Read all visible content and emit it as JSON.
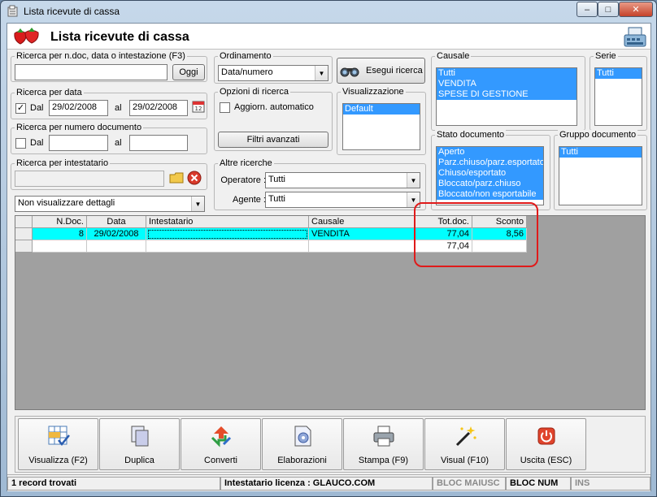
{
  "window": {
    "title": "Lista ricevute di cassa",
    "controls": {
      "minimize": "–",
      "maximize": "□",
      "close": "✕"
    }
  },
  "header": {
    "title": "Lista ricevute di cassa"
  },
  "search": {
    "ndoc": {
      "label": "Ricerca per n.doc, data o intestazione (F3)",
      "value": "",
      "today_button": "Oggi"
    },
    "by_date": {
      "label": "Ricerca per data",
      "checked": true,
      "from_label": "Dal",
      "from": "29/02/2008",
      "to_label": "al",
      "to": "29/02/2008"
    },
    "by_number": {
      "label": "Ricerca per numero documento",
      "checked": false,
      "from_label": "Dal",
      "from": "",
      "to_label": "al",
      "to": ""
    },
    "by_holder": {
      "label": "Ricerca per intestatario",
      "value": ""
    },
    "details_combo": {
      "value": "Non visualizzare dettagli"
    }
  },
  "ordering": {
    "label": "Ordinamento",
    "value": "Data/numero"
  },
  "execute_button": "Esegui ricerca",
  "options": {
    "label": "Opzioni di ricerca",
    "auto_update_label": "Aggiorn. automatico",
    "auto_update": false,
    "advanced_filters_button": "Filtri avanzati"
  },
  "view": {
    "label": "Visualizzazione",
    "items": [
      {
        "text": "Default",
        "selected": true
      }
    ]
  },
  "other": {
    "label": "Altre ricerche",
    "operator_label": "Operatore :",
    "operator": "Tutti",
    "agent_label": "Agente :",
    "agent": "Tutti"
  },
  "causale": {
    "label": "Causale",
    "items": [
      {
        "text": "Tutti",
        "selected": true
      },
      {
        "text": "VENDITA",
        "selected": true
      },
      {
        "text": "SPESE DI GESTIONE",
        "selected": true
      }
    ]
  },
  "serie": {
    "label": "Serie",
    "items": [
      {
        "text": "Tutti",
        "selected": true
      }
    ]
  },
  "stato": {
    "label": "Stato documento",
    "items": [
      {
        "text": "Aperto",
        "selected": true
      },
      {
        "text": "Parz.chiuso/parz.esportato",
        "selected": true
      },
      {
        "text": "Chiuso/esportato",
        "selected": true
      },
      {
        "text": "Bloccato/parz.chiuso",
        "selected": true
      },
      {
        "text": "Bloccato/non esportabile",
        "selected": true
      }
    ]
  },
  "gruppo": {
    "label": "Gruppo documento",
    "items": [
      {
        "text": "Tutti",
        "selected": true
      }
    ]
  },
  "grid": {
    "columns": [
      "N.Doc.",
      "Data",
      "Intestatario",
      "Causale",
      "Tot.doc.",
      "Sconto"
    ],
    "rows": [
      {
        "ndoc": "8",
        "data": "29/02/2008",
        "intestatario": "",
        "causale": "VENDITA",
        "totdoc": "77,04",
        "sconto": "8,56"
      }
    ],
    "totals": {
      "totdoc": "77,04"
    }
  },
  "toolbar": {
    "buttons": [
      {
        "label": "Visualizza (F2)",
        "icon": "view-grid-icon"
      },
      {
        "label": "Duplica",
        "icon": "duplicate-icon"
      },
      {
        "label": "Converti",
        "icon": "convert-icon"
      },
      {
        "label": "Elaborazioni",
        "icon": "processing-icon"
      },
      {
        "label": "Stampa (F9)",
        "icon": "printer-icon"
      },
      {
        "label": "Visual (F10)",
        "icon": "magic-wand-icon"
      },
      {
        "label": "Uscita (ESC)",
        "icon": "power-icon"
      }
    ]
  },
  "status": {
    "records": "1 record trovati",
    "license": "Intestatario licenza : GLAUCO.COM",
    "caps": "BLOC MAIUSC",
    "num": "BLOC NUM",
    "ins": "INS"
  },
  "colors": {
    "selection": "#3399ff",
    "row_highlight": "#00ffff",
    "annotation": "#e01a1a"
  }
}
